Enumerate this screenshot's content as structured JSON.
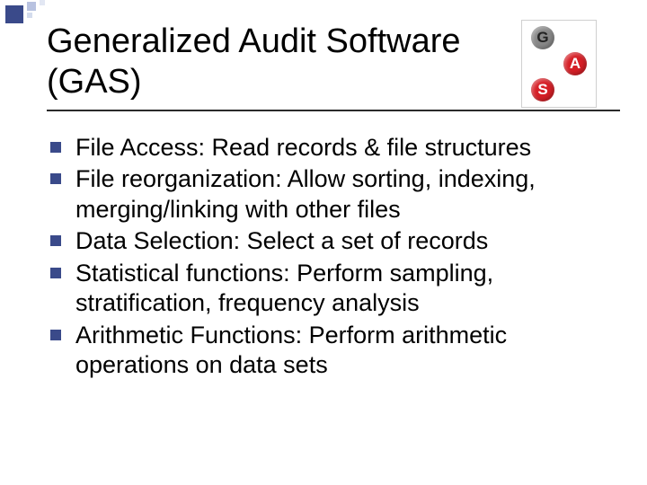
{
  "title": "Generalized Audit Software (GAS)",
  "badge": {
    "g": "G",
    "a": "A",
    "s": "S"
  },
  "bullets": [
    "File Access: Read records & file structures",
    "File reorganization: Allow sorting, indexing, merging/linking with other files",
    "Data Selection: Select a set of records",
    "Statistical functions: Perform sampling, stratification, frequency analysis",
    "Arithmetic Functions: Perform arithmetic operations on data sets"
  ]
}
